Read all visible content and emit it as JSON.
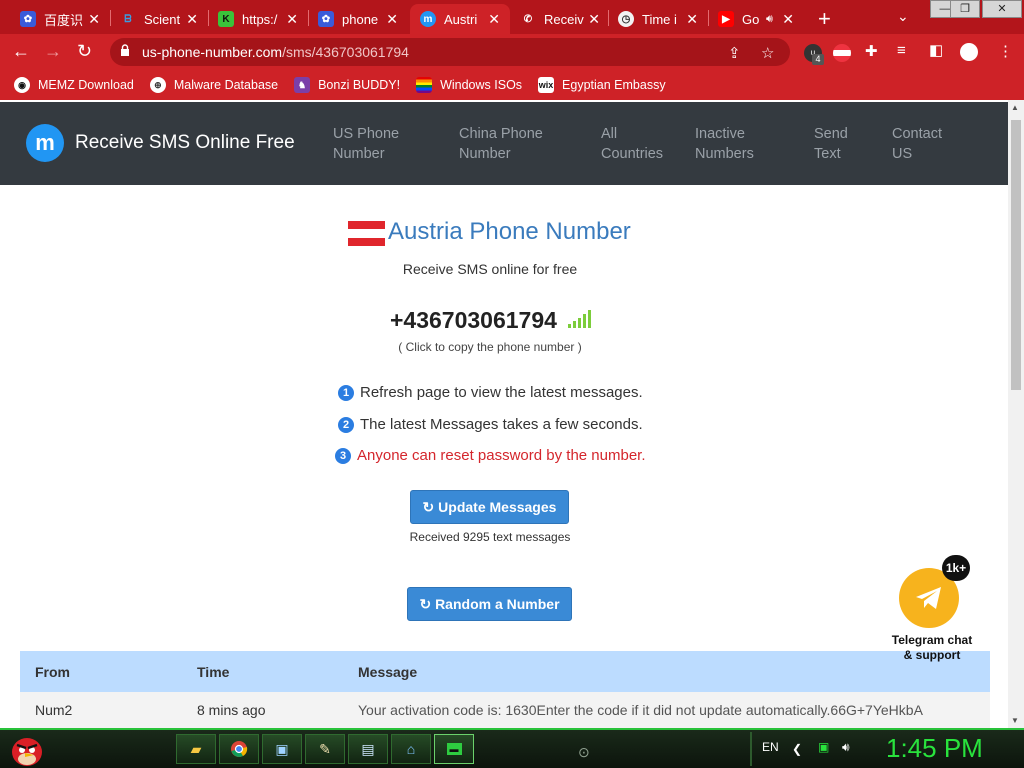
{
  "browser": {
    "tabs": [
      {
        "title": "百度识",
        "icon": "baidu-paw-icon",
        "active": false
      },
      {
        "title": "Scient",
        "icon": "bing-icon",
        "active": false
      },
      {
        "title": "https:/",
        "icon": "k-icon",
        "active": false
      },
      {
        "title": "phone",
        "icon": "baidu-paw-icon",
        "active": false
      },
      {
        "title": "Austri",
        "icon": "m-chat-icon",
        "active": true
      },
      {
        "title": "Receiv",
        "icon": "phone-icon",
        "active": false
      },
      {
        "title": "Time i",
        "icon": "time-icon",
        "active": false
      },
      {
        "title": "Go",
        "icon": "youtube-icon",
        "active": false
      }
    ],
    "url_host": "us-phone-number.com",
    "url_path": "/sms/436703061794",
    "extension_badge": "4",
    "bookmarks": [
      {
        "label": "MEMZ Download",
        "icon": "github-icon"
      },
      {
        "label": "Malware Database",
        "icon": "globe-icon"
      },
      {
        "label": "Bonzi BUDDY!",
        "icon": "bonzi-icon"
      },
      {
        "label": "Windows ISOs",
        "icon": "rainbow-flag-icon"
      },
      {
        "label": "Egyptian Embassy",
        "icon": "wix-icon"
      }
    ],
    "accent": "#ce2227"
  },
  "site": {
    "brand": "Receive SMS Online Free",
    "nav": [
      {
        "line1": "US Phone",
        "line2": "Number"
      },
      {
        "line1": "China Phone",
        "line2": "Number"
      },
      {
        "line1": "All",
        "line2": "Countries"
      },
      {
        "line1": "Inactive",
        "line2": "Numbers"
      },
      {
        "line1": "Send",
        "line2": "Text"
      },
      {
        "line1": "Contact",
        "line2": "US"
      }
    ]
  },
  "page": {
    "title": "Austria Phone Number",
    "subtitle": "Receive SMS online for free",
    "phone": "+436703061794",
    "copy_hint": "( Click to copy the phone number )",
    "steps": [
      {
        "num": "1",
        "text": "Refresh page to view the latest messages."
      },
      {
        "num": "2",
        "text": "The latest Messages takes a few seconds."
      },
      {
        "num": "3",
        "text": "Anyone can reset password by the number."
      }
    ],
    "update_button": "↻ Update Messages",
    "received": "Received 9295 text messages",
    "random_button": "↻ Random a Number",
    "table": {
      "headers": [
        "From",
        "Time",
        "Message"
      ],
      "rows": [
        {
          "from": "Num2",
          "time": "8 mins ago",
          "message": "Your activation code is: 1630Enter the code if it did not update automatically.66G+7YeHkbA"
        }
      ]
    },
    "telegram": {
      "badge": "1k+",
      "line1": "Telegram chat",
      "line2": "& support"
    }
  },
  "taskbar": {
    "language": "EN",
    "clock": "1:45 PM",
    "accent": "#29e33d"
  }
}
